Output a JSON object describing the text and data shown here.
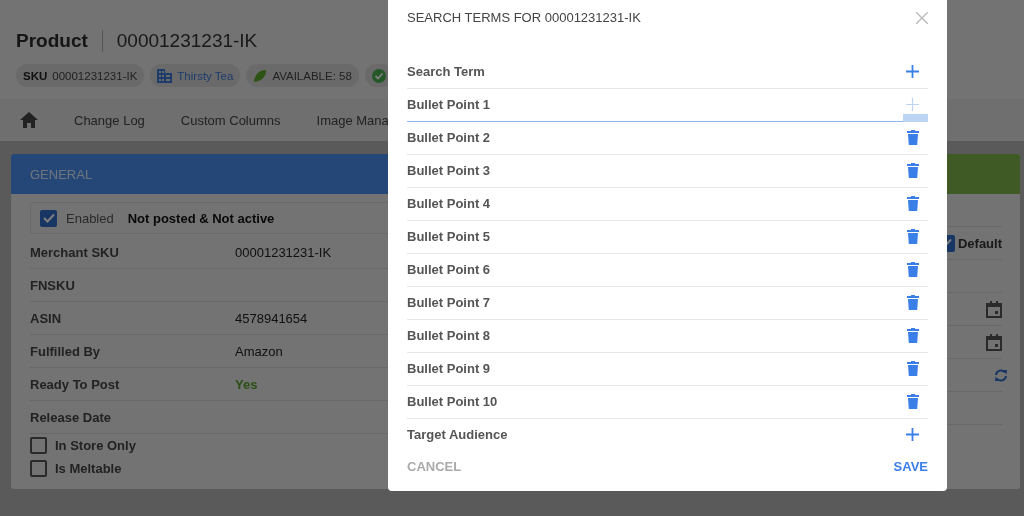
{
  "page": {
    "title": "Product",
    "product_id": "00001231231-IK",
    "chips": [
      {
        "kind": "sku",
        "label": "SKU",
        "value": "00001231231-IK"
      },
      {
        "kind": "brand",
        "value": "Thirsty Tea"
      },
      {
        "kind": "stock",
        "value": "AVAILABLE: 58"
      },
      {
        "kind": "status"
      }
    ],
    "tabs": [
      {
        "kind": "home"
      },
      {
        "kind": "text",
        "label": "Change Log"
      },
      {
        "kind": "text",
        "label": "Custom Columns"
      },
      {
        "kind": "text",
        "label": "Image Mana"
      }
    ],
    "general": {
      "title": "GENERAL",
      "enabled": {
        "label": "Enabled",
        "checked": true
      },
      "status": "Not posted & Not active",
      "fields": [
        {
          "label": "Merchant SKU",
          "value": "00001231231-IK"
        },
        {
          "label": "FNSKU"
        },
        {
          "label": "ASIN",
          "value": "4578941654"
        },
        {
          "label": "Fulfilled By",
          "value": "Amazon"
        },
        {
          "label": "Ready To Post",
          "value": "Yes",
          "kind": "positive"
        },
        {
          "label": "Release Date"
        }
      ],
      "options": [
        {
          "label": "In Store Only",
          "checked": false
        },
        {
          "label": "Is Meltable",
          "checked": false
        }
      ]
    },
    "side_panel": {
      "default": {
        "label": "Default",
        "checked": true
      },
      "rows": [
        {
          "kind": "plain"
        },
        {
          "kind": "date"
        },
        {
          "kind": "date"
        },
        {
          "kind": "refresh"
        },
        {
          "kind": "plain"
        },
        {
          "kind": "plain"
        }
      ]
    }
  },
  "dialog": {
    "title": "SEARCH TERMS FOR 00001231231-IK",
    "rows": [
      {
        "label": "Search Term",
        "kind": "add",
        "focused": false
      },
      {
        "label": "Bullet Point 1",
        "kind": "add",
        "focused": true
      },
      {
        "label": "Bullet Point 2",
        "kind": "delete",
        "focused": false
      },
      {
        "label": "Bullet Point 3",
        "kind": "delete",
        "focused": false
      },
      {
        "label": "Bullet Point 4",
        "kind": "delete",
        "focused": false
      },
      {
        "label": "Bullet Point 5",
        "kind": "delete",
        "focused": false
      },
      {
        "label": "Bullet Point 6",
        "kind": "delete",
        "focused": false
      },
      {
        "label": "Bullet Point 7",
        "kind": "delete",
        "focused": false
      },
      {
        "label": "Bullet Point 8",
        "kind": "delete",
        "focused": false
      },
      {
        "label": "Bullet Point 9",
        "kind": "delete",
        "focused": false
      },
      {
        "label": "Bullet Point 10",
        "kind": "delete",
        "focused": false
      },
      {
        "label": "Target Audience",
        "kind": "add",
        "focused": false
      }
    ],
    "buttons": [
      {
        "label": "CANCEL",
        "kind": "secondary"
      },
      {
        "label": "SAVE",
        "kind": "primary"
      }
    ]
  }
}
